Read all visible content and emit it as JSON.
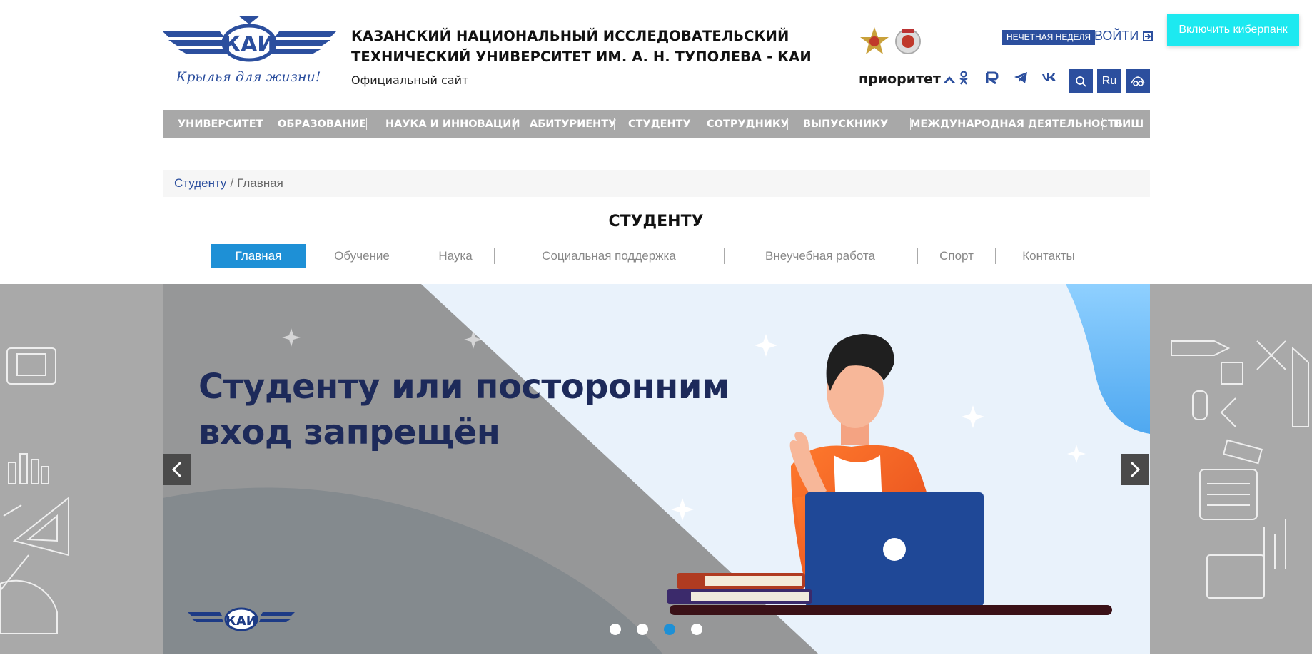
{
  "header": {
    "logo_motto": "Крылья для жизни!",
    "logo_text": "КАИ",
    "title_line1": "КАЗАНСКИЙ НАЦИОНАЛЬНЫЙ ИССЛЕДОВАТЕЛЬСКИЙ",
    "title_line2": "ТЕХНИЧЕСКИЙ УНИВЕРСИТЕТ ИМ. А. Н. ТУПОЛЕВА - КАИ",
    "subtitle": "Официальный сайт",
    "week_badge": "НЕЧЕТНАЯ НЕДЕЛЯ",
    "login_label": "ВОЙТИ",
    "cyberpunk_button": "Включить киберпанк",
    "priority_label": "приоритет",
    "lang_button": "Ru"
  },
  "nav": {
    "items": [
      {
        "label": "УНИВЕРСИТЕТ"
      },
      {
        "label": "ОБРАЗОВАНИЕ"
      },
      {
        "label": "НАУКА И ИННОВАЦИИ"
      },
      {
        "label": "АБИТУРИЕНТУ"
      },
      {
        "label": "СТУДЕНТУ"
      },
      {
        "label": "СОТРУДНИКУ"
      },
      {
        "label": "ВЫПУСКНИКУ"
      },
      {
        "label": "МЕЖДУНАРОДНАЯ ДЕЯТЕЛЬНОСТЬ"
      },
      {
        "label": "ПИШ"
      }
    ]
  },
  "breadcrumb": {
    "parent": "Студенту",
    "separator": "/",
    "current": "Главная"
  },
  "page": {
    "title": "СТУДЕНТУ"
  },
  "tabs": [
    {
      "label": "Главная",
      "active": true
    },
    {
      "label": "Обучение"
    },
    {
      "label": "Наука"
    },
    {
      "label": "Социальная поддержка"
    },
    {
      "label": "Внеучебная работа"
    },
    {
      "label": "Спорт"
    },
    {
      "label": "Контакты"
    }
  ],
  "slider": {
    "headline_line1": "Студенту или посторонним",
    "headline_line2": "вход запрещён",
    "logo_text": "КАИ",
    "slide_count": 4,
    "active_slide": 3
  },
  "colors": {
    "brand_blue": "#2c4f9e",
    "nav_grey": "#a8a8a8",
    "tab_active": "#1e90d6",
    "cyber_button": "#1de9f0"
  }
}
